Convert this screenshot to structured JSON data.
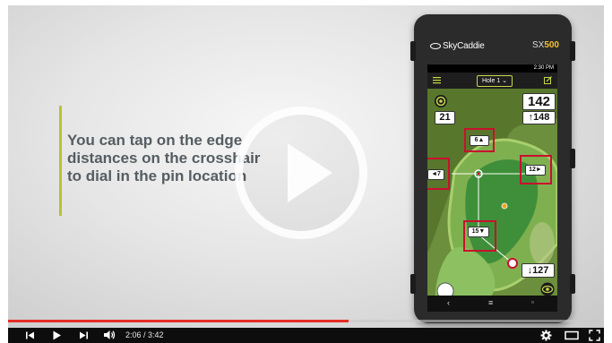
{
  "caption": {
    "line1": "You can tap on the edge",
    "line2": "distances on the crosshair",
    "line3": "to dial in the pin location"
  },
  "device": {
    "brand": "SkyCaddie",
    "model_prefix": "SX",
    "model_number": "500",
    "status_time": "2:30 PM",
    "hole_select": "Hole 1",
    "distance_main": "142",
    "distance_front": "21",
    "distance_back": "↑148",
    "distance_layup": "↓127",
    "cross_top": "6▲",
    "cross_left": "◄7",
    "cross_right": "12►",
    "cross_bottom": "15▼"
  },
  "player": {
    "current_time": "2:06",
    "separator": " / ",
    "duration": "3:42",
    "progress": 0.572
  },
  "icons": {
    "prev": "skip-previous-icon",
    "play": "play-icon",
    "next": "skip-next-icon",
    "volume": "volume-icon",
    "settings": "gear-icon",
    "theater": "theater-mode-icon",
    "fullscreen": "fullscreen-icon",
    "big_play": "big-play-icon"
  },
  "colors": {
    "accent": "#b5c431",
    "progress": "#e52d27",
    "highlight_box": "#c8102e",
    "caption_text": "#555d62"
  }
}
